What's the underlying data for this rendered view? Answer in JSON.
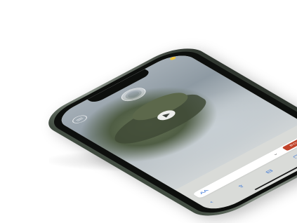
{
  "status": {
    "time": "",
    "battery_color": "#f2c53a"
  },
  "site": {
    "logo_icon": "circle-logo-icon",
    "menu_icon": "menu-icon",
    "hero_title": "",
    "hero_subtitle": "",
    "hero_link": "",
    "play_icon": "play-icon"
  },
  "browser": {
    "page_label": "",
    "aa_label": "AA",
    "url": "",
    "chevron_icon": "chevron-down-icon",
    "book_label": "BOOK",
    "accent": "#c1442b",
    "link_color": "#2f6fd6"
  },
  "toolbar": {
    "icons": [
      "back-icon",
      "share-icon",
      "bookmarks-icon",
      "tabs-icon"
    ],
    "glyphs": [
      "‹",
      "⇪",
      "⊟",
      "❐"
    ],
    "reload_glyph": "↻"
  }
}
